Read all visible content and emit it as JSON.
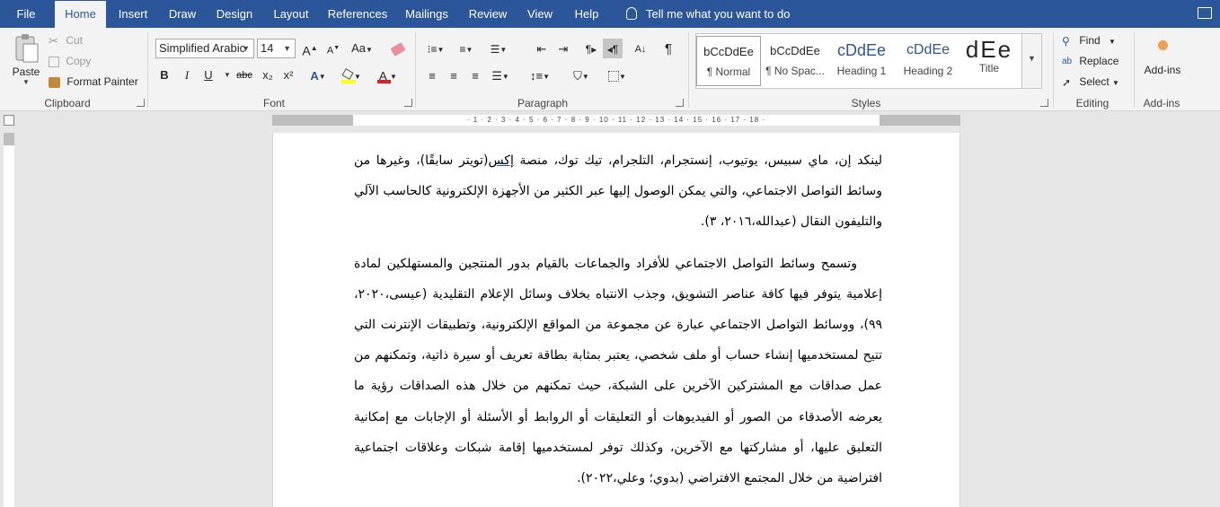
{
  "tabs": [
    "File",
    "Home",
    "Insert",
    "Draw",
    "Design",
    "Layout",
    "References",
    "Mailings",
    "Review",
    "View",
    "Help"
  ],
  "active_tab": "Home",
  "tell_me": "Tell me what you want to do",
  "clipboard": {
    "paste": "Paste",
    "cut": "Cut",
    "copy": "Copy",
    "format_painter": "Format Painter",
    "label": "Clipboard"
  },
  "font": {
    "name": "Simplified Arabic",
    "size": "14",
    "label": "Font",
    "bold": "B",
    "italic": "I",
    "underline": "U",
    "strike": "abc",
    "subscript": "x₂",
    "superscript": "x²",
    "grow": "A",
    "shrink": "A",
    "case": "Aa",
    "highlight_color": "#ffff00",
    "font_color": "#ff0000"
  },
  "paragraph": {
    "label": "Paragraph"
  },
  "styles": {
    "label": "Styles",
    "items": [
      {
        "sample": "bCcDdEe",
        "name": "¶ Normal"
      },
      {
        "sample": "bCcDdEe",
        "name": "¶ No Spac..."
      },
      {
        "sample": "cDdEe",
        "name": "Heading 1"
      },
      {
        "sample": "cDdEe",
        "name": "Heading 2"
      },
      {
        "sample": "dEe",
        "name": "Title"
      }
    ]
  },
  "editing": {
    "label": "Editing",
    "find": "Find",
    "replace": "Replace",
    "select": "Select"
  },
  "addins": {
    "button": "Add-ins",
    "label": "Add-ins"
  },
  "ruler": {
    "ticks": "· 18 · 17 · 16 · 15 · 14 · 13 · 12 · 11 · 10 · 9 · 8 · 7 · 6 · 5 · 4 · 3 · 2 · 1 ·"
  },
  "document": {
    "p1": {
      "before": "لينكد إن، ماي سبيس، يوتيوب، إنستجرام، التلجرام، تيك توك، منصة ",
      "underlined": "إكس",
      "after": "(تويتر سابقًا)، وغيرها من وسائط التواصل الاجتماعي، والتي يمكن الوصول إليها عبر الكثير من الأجهزة الإلكترونية كالحاسب الآلي والتليفون النقال (عبدالله،٢٠١٦، ٣)."
    },
    "p2": "وتسمح وسائط التواصل الاجتماعي للأفراد والجماعات بالقيام بدور المنتجين والمستهلكين لمادة إعلامية يتوفر فيها كافة عناصر التشويق، وجذب الانتباه بخلاف وسائل الإعلام التقليدية (عيسى،٢٠٢٠، ٩٩)، ووسائط التواصل الاجتماعي عبارة عن مجموعة من المواقع الإلكترونية، وتطبيقات الإنترنت التي تتيح لمستخدميها إنشاء حساب أو ملف شخصي، يعتبر بمثابة بطاقة تعريف أو سيرة ذاتية، وتمكنهم من عمل صداقات مع المشتركين الآخرين على الشبكة، حيث تمكنهم من خلال هذه الصداقات رؤية ما يعرضه الأصدقاء من الصور أو الفيديوهات أو التعليقات أو الروابط أو الأسئلة أو الإجابات مع إمكانية التعليق عليها، أو مشاركتها مع الآخرين، وكذلك توفر لمستخدميها إقامة شبكات وعلاقات اجتماعية افتراضية من خلال المجتمع الافتراضي (بدوي؛ وعلي،٢٠٢٢)."
  }
}
